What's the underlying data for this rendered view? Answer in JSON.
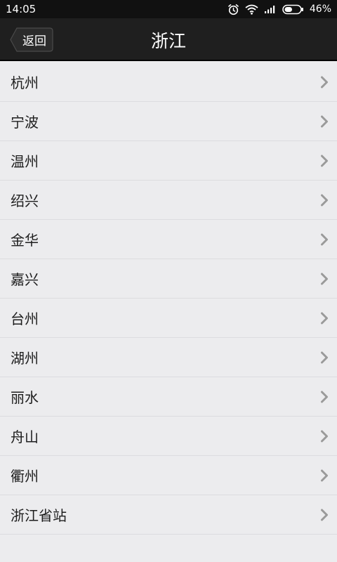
{
  "status_bar": {
    "time": "14:05",
    "battery": "46%",
    "icons": [
      "alarm-icon",
      "wifi-icon",
      "signal-icon",
      "battery-icon"
    ]
  },
  "header": {
    "back_label": "返回",
    "title": "浙江"
  },
  "cities": [
    {
      "label": "杭州"
    },
    {
      "label": "宁波"
    },
    {
      "label": "温州"
    },
    {
      "label": "绍兴"
    },
    {
      "label": "金华"
    },
    {
      "label": "嘉兴"
    },
    {
      "label": "台州"
    },
    {
      "label": "湖州"
    },
    {
      "label": "丽水"
    },
    {
      "label": "舟山"
    },
    {
      "label": "衢州"
    },
    {
      "label": "浙江省站"
    }
  ],
  "colors": {
    "status_bar_bg": "#111111",
    "title_bar_bg": "#1f1f1f",
    "list_bg": "#ececee",
    "divider": "#dcdcdf",
    "chevron": "#9a9a9a"
  }
}
